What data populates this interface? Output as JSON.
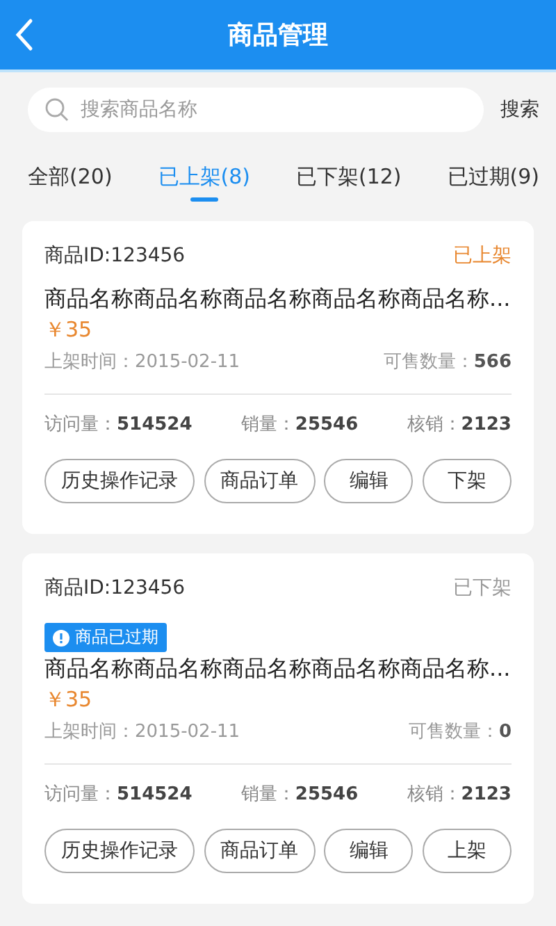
{
  "header": {
    "title": "商品管理"
  },
  "search": {
    "placeholder": "搜索商品名称",
    "button": "搜索"
  },
  "tabs": [
    {
      "label": "全部(20)",
      "selected": false
    },
    {
      "label": "已上架(8)",
      "selected": true
    },
    {
      "label": "已下架(12)",
      "selected": false
    },
    {
      "label": "已过期(9)",
      "selected": false
    }
  ],
  "products": [
    {
      "id": "商品ID:123456",
      "status": "已上架",
      "color": "#e8872f",
      "expired": false,
      "name": "商品名称商品名称商品名称商品名称商品名称...",
      "price": "￥35",
      "listed_time": "上架时间：2015-02-11",
      "stock": "可售数量：**566**",
      "stats": [
        "访问量：**514524**",
        "销量：**25546**",
        "核销：**2123**"
      ],
      "actions": [
        "历史操作记录",
        "商品订单",
        "编辑",
        "下架"
      ]
    },
    {
      "id": "商品ID:123456",
      "status": "已下架",
      "color": "#999999",
      "expired": true,
      "expired_label": "商品已过期",
      "name": "商品名称商品名称商品名称商品名称商品名称...",
      "price": "￥35",
      "listed_time": "上架时间：2015-02-11",
      "stock": "可售数量：**0**",
      "stats": [
        "访问量：**514524**",
        "销量：**25546**",
        "核销：**2123**"
      ],
      "actions": [
        "历史操作记录",
        "商品订单",
        "编辑",
        "上架"
      ]
    }
  ]
}
